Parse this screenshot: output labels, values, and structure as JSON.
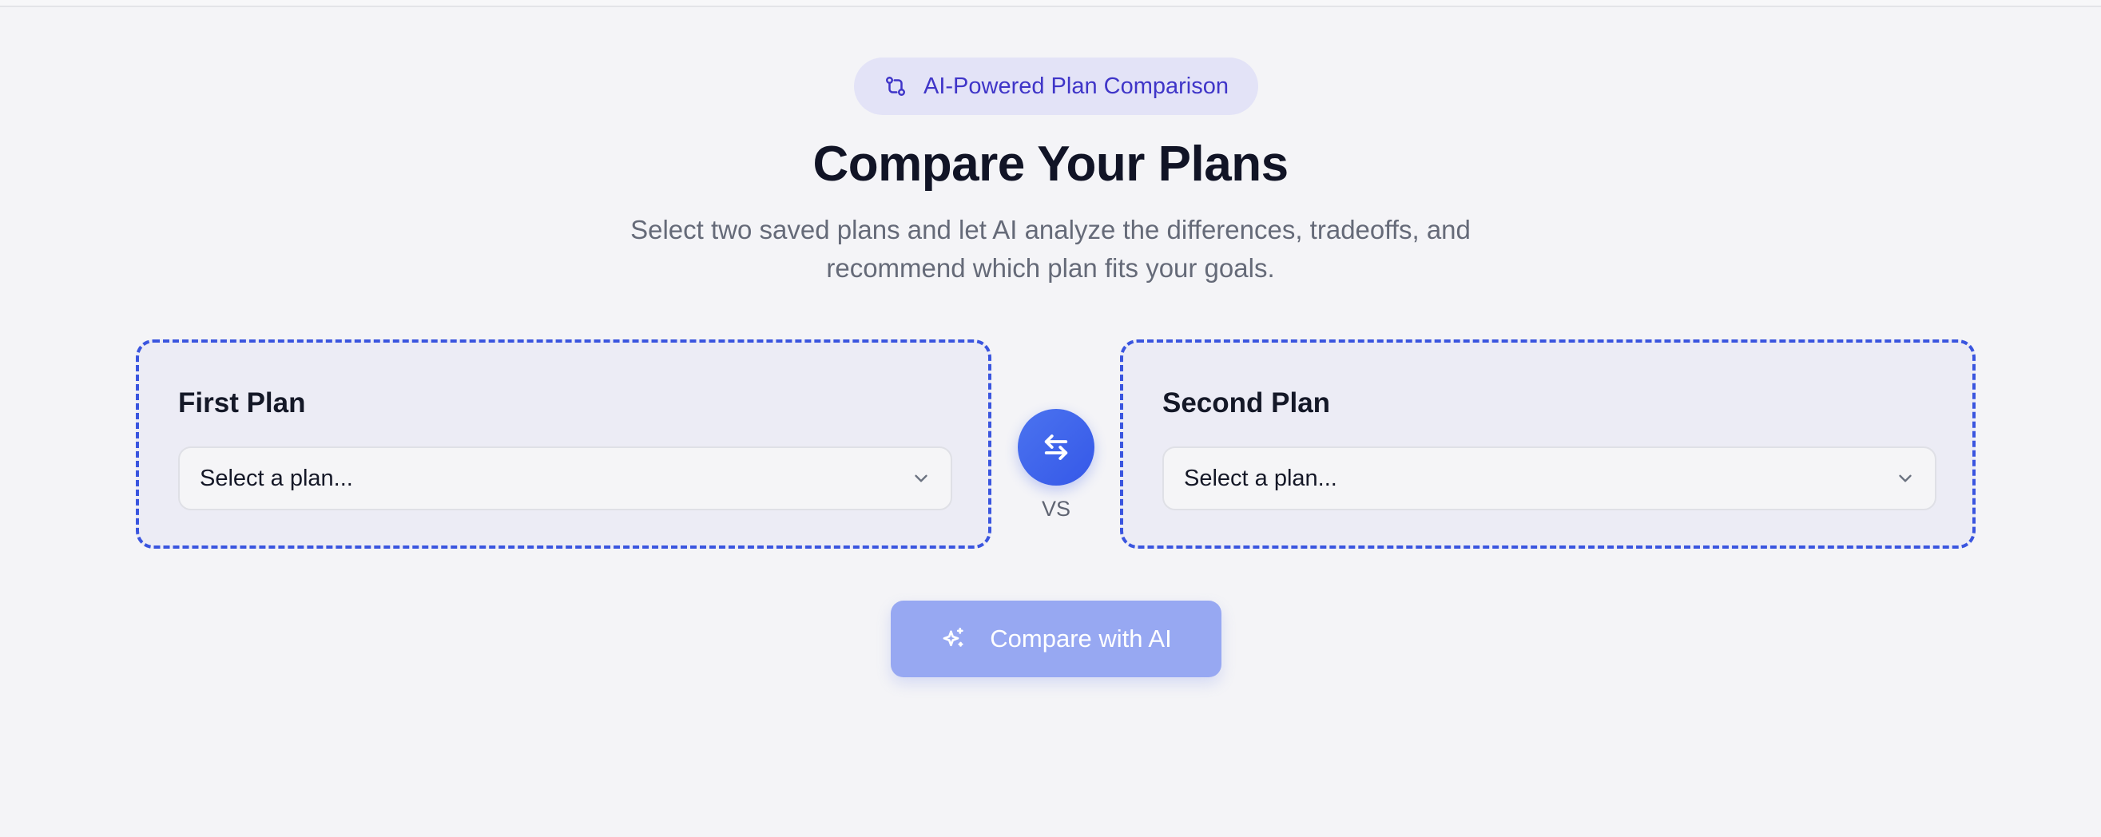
{
  "badge": {
    "icon": "git-compare-icon",
    "label": "AI-Powered Plan Comparison"
  },
  "header": {
    "title": "Compare Your Plans",
    "subtitle_line1": "Select two saved plans and let AI analyze the differences, tradeoffs, and",
    "subtitle_line2": "recommend which plan fits your goals."
  },
  "first_plan": {
    "title": "First Plan",
    "select_value": "Select a plan..."
  },
  "second_plan": {
    "title": "Second Plan",
    "select_value": "Select a plan..."
  },
  "swap": {
    "icon": "swap-arrows-icon",
    "vs_label": "VS"
  },
  "compare_button": {
    "icon": "sparkles-icon",
    "label": "Compare with AI"
  },
  "colors": {
    "accent": "#3558e8",
    "badge_text": "#3f35c8",
    "badge_bg": "#e3e3f7",
    "compare_button_bg": "#97a8f2",
    "dashed_border": "#3a55df",
    "page_bg": "#f4f4f7"
  }
}
